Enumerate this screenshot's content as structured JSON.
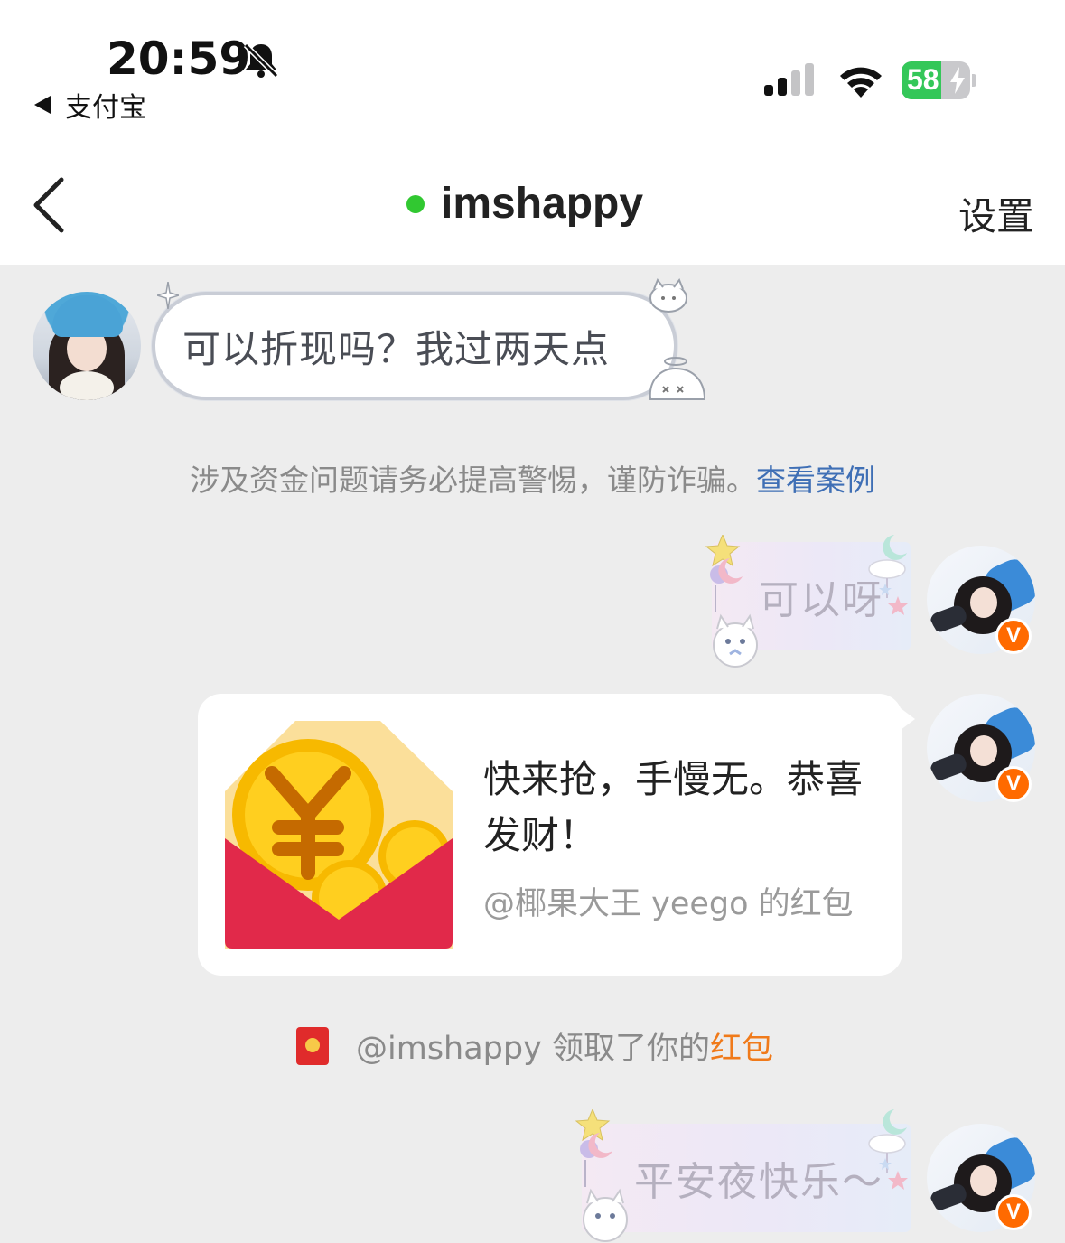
{
  "status_bar": {
    "time": "20:59",
    "back_app": "支付宝",
    "battery_level": "58",
    "battery_fraction": 0.58,
    "icons": [
      "bell-slash-icon",
      "signal-icon",
      "wifi-icon",
      "battery-charging-icon"
    ]
  },
  "nav": {
    "title": "imshappy",
    "settings": "设置",
    "online_color": "#31c831"
  },
  "messages": {
    "incoming_text": "可以折现吗？我过两天点",
    "warning_text": "涉及资金问题请务必提高警惕，谨防诈骗。",
    "warning_link": "查看案例",
    "reply_1": "可以呀",
    "red_packet": {
      "title": "快来抢，手慢无。恭喜发财！",
      "from": "@椰果大王 yeego 的红包"
    },
    "received_prefix": "@imshappy 领取了你的",
    "received_highlight": "红包",
    "reply_2": "平安夜快乐～"
  },
  "badge": "V",
  "colors": {
    "background": "#ededed",
    "link": "#3f6fb5",
    "highlight": "#f07a1a",
    "verified_badge": "#ff6a00",
    "battery": "#34c759"
  }
}
